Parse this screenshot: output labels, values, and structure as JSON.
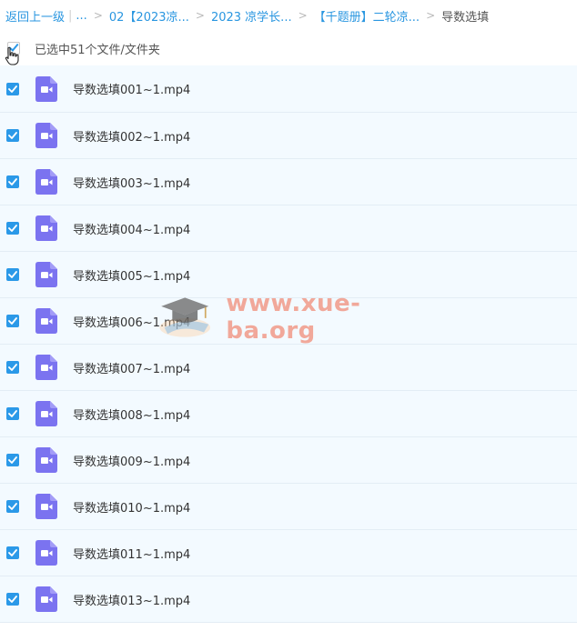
{
  "breadcrumb": {
    "back_label": "返回上一级",
    "ellipsis": "...",
    "items": [
      "02【2023凉...",
      "2023 凉学长...",
      "【千题册】二轮凉...",
      "导数选填"
    ]
  },
  "selection": {
    "text": "已选中51个文件/文件夹",
    "checked": true
  },
  "files": [
    {
      "name": "导数选填001~1.mp4",
      "checked": true
    },
    {
      "name": "导数选填002~1.mp4",
      "checked": true
    },
    {
      "name": "导数选填003~1.mp4",
      "checked": true
    },
    {
      "name": "导数选填004~1.mp4",
      "checked": true
    },
    {
      "name": "导数选填005~1.mp4",
      "checked": true
    },
    {
      "name": "导数选填006~1.mp4",
      "checked": true
    },
    {
      "name": "导数选填007~1.mp4",
      "checked": true
    },
    {
      "name": "导数选填008~1.mp4",
      "checked": true
    },
    {
      "name": "导数选填009~1.mp4",
      "checked": true
    },
    {
      "name": "导数选填010~1.mp4",
      "checked": true
    },
    {
      "name": "导数选填011~1.mp4",
      "checked": true
    },
    {
      "name": "导数选填013~1.mp4",
      "checked": true
    }
  ],
  "watermark": {
    "text": "www.xue-ba.org"
  },
  "colors": {
    "accent": "#2b99e8",
    "video_icon": "#7b73f0",
    "row_bg": "#f3faff"
  },
  "icons": {
    "file": "video-file-icon",
    "cursor": "hand-pointer-icon",
    "checkbox": "checkbox-checked-icon"
  }
}
